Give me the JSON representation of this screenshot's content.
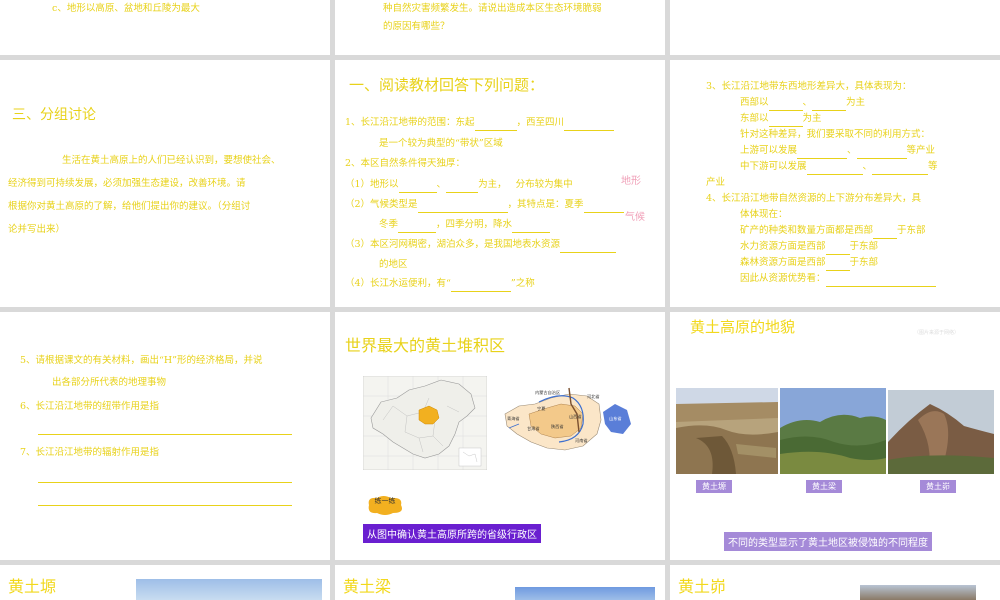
{
  "s1": {
    "line_c": "c、地形以高原、盆地和丘陵为最大"
  },
  "s2": {
    "line1": "种自然灾害频繁发生。请说出造成本区生态环境脆弱",
    "line2": "的原因有哪些？"
  },
  "s4": {
    "title": "三、分组讨论",
    "para1": "生活在黄土高原上的人们已经认识到，要想使社会、",
    "para2": "经济得到可持续发展，必须加强生态建设，改善环境。请",
    "para3": "根据你对黄土高原的了解，给他们提出你的建议。（分组讨",
    "para4": "论并写出来）"
  },
  "s5": {
    "title": "一、阅读教材回答下列问题：",
    "q1a": "1、长江沿江地带的范围：东起",
    "q1b": "，西至四川",
    "q1c": "是一个较为典型的“带状”区域",
    "q2": "2、本区自然条件得天独厚：",
    "q2_1a": "（1）地形以",
    "q2_1b": "、",
    "q2_1c": "为主，",
    "q2_1d": "分布较为集中",
    "side1": "地形",
    "q2_2a": "（2）气候类型是",
    "q2_2b": "，其特点是：夏季",
    "q2_2c": "冬季",
    "q2_2d": "，四季分明，降水",
    "side2": "气候",
    "q2_3a": "（3）本区河网稠密，湖泊众多，是我国地表水资源",
    "q2_3b": "的地区",
    "q2_4a": "（4）长江水运便利，有“",
    "q2_4b": "”之称"
  },
  "s6": {
    "q3": "3、长江沿江地带东西地形差异大，具体表现为：",
    "q3a": "西部以",
    "q3a2": "、",
    "q3a3": "为主",
    "q3b": "东部以",
    "q3b2": "为主",
    "q3c": "针对这种差异，我们要采取不同的利用方式：",
    "q3d": "上游可以发展",
    "q3d2": "、",
    "q3d3": "等产业",
    "q3e": "中下游可以发展",
    "q3e2": "、",
    "q3e3": "等",
    "q3f": "产业",
    "q4": "4、长江沿江地带自然资源的上下游分布差异大，具",
    "q4b": "体体现在：",
    "q4c": "矿产的种类和数量方面都是西部",
    "q4c2": "于东部",
    "q4d": "水力资源方面是西部",
    "q4d2": "于东部",
    "q4e": "森林资源方面是西部",
    "q4e2": "于东部",
    "q4f": "因此从资源优势看："
  },
  "s7": {
    "q5": "5、请根据课文的有关材料，画出“H”形的经济格局，并说",
    "q5b": "出各部分所代表的地理事物",
    "q6": "6、长江沿江地带的纽带作用是指",
    "q7": "7、长江沿江地带的辐射作用是指"
  },
  "s8": {
    "title": "世界最大的黄土堆积区",
    "bubble": "练一练",
    "caption": "从图中确认黄土高原所跨的省级行政区",
    "map2_labels": [
      "内蒙古自治区",
      "河北省",
      "山西省",
      "陕西省",
      "宁夏",
      "甘肃省",
      "青海省",
      "河南省",
      "山东省"
    ]
  },
  "s9": {
    "title": "黄土高原的地貌",
    "small_note": "（图片来源于网络）",
    "tags": [
      "黄土塬",
      "黄土梁",
      "黄土峁"
    ],
    "caption": "不同的类型显示了黄土地区被侵蚀的不同程度"
  },
  "s10": {
    "title": "黄土塬"
  },
  "s11": {
    "title": "黄土梁"
  },
  "s12": {
    "title": "黄土峁"
  },
  "colors": {
    "accent_yellow": "#e8d21a",
    "purple": "#6a1fd0",
    "lavender": "#a58ad8",
    "gap": "#d9d9d9"
  }
}
